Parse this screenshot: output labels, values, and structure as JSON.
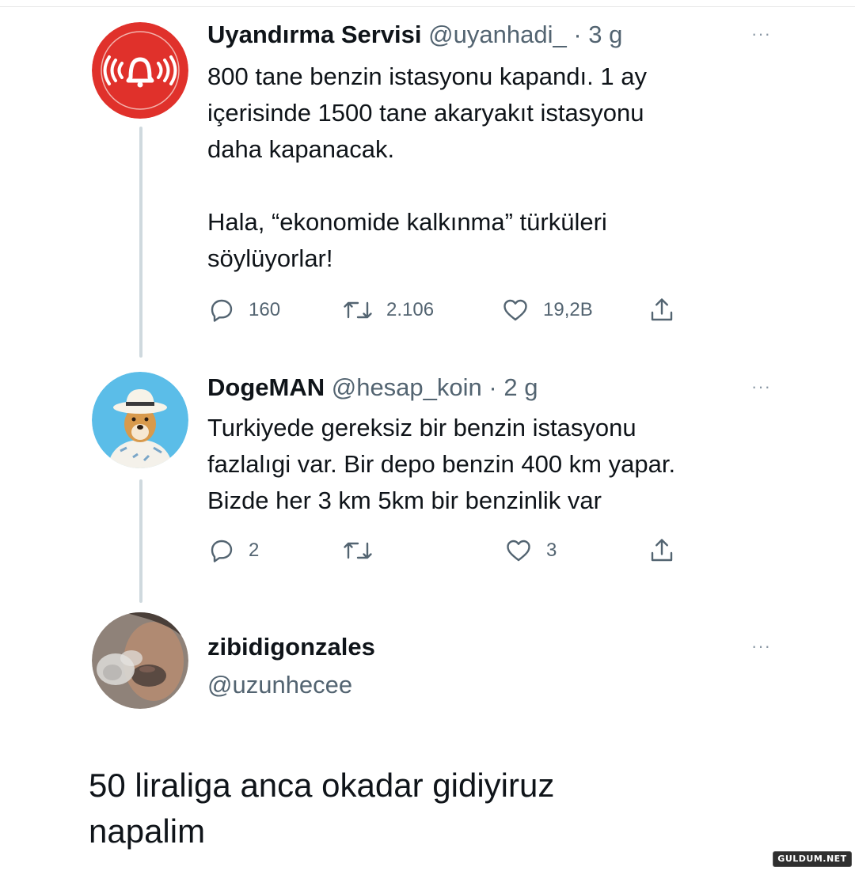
{
  "tweets": [
    {
      "name": "Uyandırma Servisi",
      "handle": "@uyanhadi_",
      "separator": "·",
      "time": "3 g",
      "more": "···",
      "text": [
        "800 tane benzin istasyonu kapandı. 1 ay",
        "içerisinde 1500 tane akaryakıt istasyonu",
        "daha kapanacak.",
        "Hala, “ekonomide kalkınma” türküleri",
        "söylüyorlar!"
      ],
      "stats": {
        "replies": "160",
        "retweets": "2.106",
        "likes": "19,2B"
      },
      "avatar_color": "#e0312b"
    },
    {
      "name": "DogeMAN",
      "handle": "@hesap_koin",
      "separator": "·",
      "time": "2 g",
      "more": "···",
      "text": [
        "Turkiyede gereksiz bir benzin istasyonu",
        "fazlalıgi var. Bir depo benzin 400 km yapar.",
        "Bizde her 3 km 5km bir benzinlik var"
      ],
      "stats": {
        "replies": "2",
        "retweets": "",
        "likes": "3"
      },
      "avatar_color": "#5bbde8"
    }
  ],
  "quote_tweet": {
    "name": "zibidigonzales",
    "handle": "@uzunhecee",
    "more": "···",
    "text": [
      "50 liraliga anca okadar gidiyiruz",
      "napalim"
    ]
  },
  "watermark": "GULDUM.NET",
  "icons": [
    "reply-icon",
    "retweet-icon",
    "like-icon",
    "share-icon",
    "more-icon",
    "bell-icon"
  ]
}
